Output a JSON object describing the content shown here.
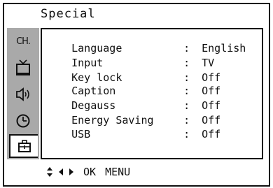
{
  "title": "Special",
  "sidebar": {
    "tabs": [
      {
        "name": "channel-tab",
        "icon": "ch-icon",
        "text": "CH."
      },
      {
        "name": "picture-tab",
        "icon": "tv-icon"
      },
      {
        "name": "sound-tab",
        "icon": "speaker-icon"
      },
      {
        "name": "time-tab",
        "icon": "clock-icon"
      },
      {
        "name": "special-tab",
        "icon": "toolbox-icon",
        "selected": true
      }
    ]
  },
  "menu": {
    "items": [
      {
        "label": "Language",
        "value": "English"
      },
      {
        "label": "Input",
        "value": "TV"
      },
      {
        "label": "Key lock",
        "value": "Off"
      },
      {
        "label": "Caption",
        "value": "Off"
      },
      {
        "label": "Degauss",
        "value": "Off"
      },
      {
        "label": "Energy Saving",
        "value": "Off"
      },
      {
        "label": "USB",
        "value": "Off"
      }
    ],
    "separator": ":"
  },
  "footer": {
    "nav_icons": [
      "up-down-arrow-icon",
      "left-arrow-icon",
      "right-arrow-icon"
    ],
    "ok_label": "OK",
    "menu_label": "MENU"
  }
}
